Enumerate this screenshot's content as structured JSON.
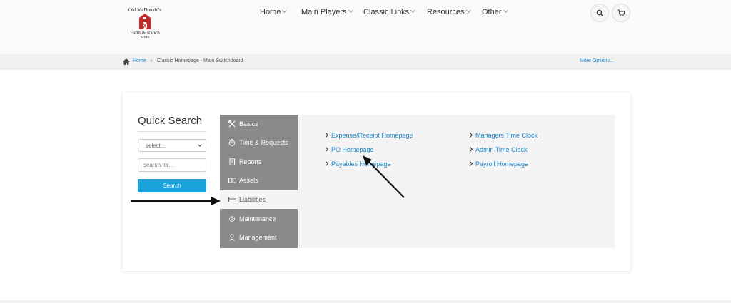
{
  "logo": {
    "line1": "Old McDonald's",
    "line2": "Farm & Ranch",
    "line3": "Store"
  },
  "nav": [
    {
      "label": "Home"
    },
    {
      "label": "Main Players"
    },
    {
      "label": "Classic Links"
    },
    {
      "label": "Resources"
    },
    {
      "label": "Other"
    }
  ],
  "header_icons": {
    "search": "search-icon",
    "cart": "cart-icon"
  },
  "breadcrumb": {
    "home": "Home",
    "separator": "»",
    "current": "Classic Homepage - Main Switchboard",
    "more": "More Options..."
  },
  "quick_search": {
    "title": "Quick Search",
    "select_value": "select...",
    "input_placeholder": "search for...",
    "button": "Search"
  },
  "menu": [
    {
      "label": "Basics",
      "icon": "tools-icon",
      "active": false
    },
    {
      "label": "Time & Requests",
      "icon": "stopwatch-icon",
      "active": false
    },
    {
      "label": "Reports",
      "icon": "document-icon",
      "active": false
    },
    {
      "label": "Assets",
      "icon": "cash-icon",
      "active": false
    },
    {
      "label": "Liabilities",
      "icon": "card-icon",
      "active": true
    },
    {
      "label": "Maintenance",
      "icon": "gear-icon",
      "active": false
    },
    {
      "label": "Management",
      "icon": "people-icon",
      "active": false
    }
  ],
  "links": {
    "col1": [
      "Expense/Receipt Homepage",
      "PO Homepage",
      "Payables Homepage"
    ],
    "col2": [
      "Managers Time Clock",
      "Admin Time Clock",
      "Payroll Homepage"
    ]
  },
  "colors": {
    "accent": "#1ba3dc",
    "link": "#1b87c9",
    "menu_bg": "#8a8a8a",
    "content_bg": "#f4f4f4"
  }
}
